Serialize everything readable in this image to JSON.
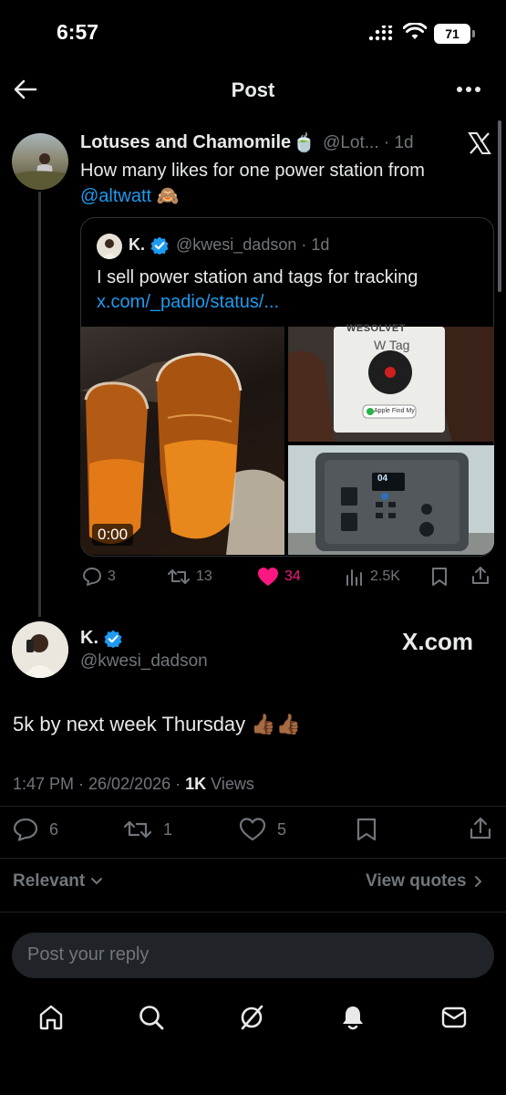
{
  "status_bar": {
    "time": "6:57",
    "battery": "71"
  },
  "header": {
    "title": "Post"
  },
  "parent_post": {
    "author_name": "Lotuses and Chamomile",
    "author_emoji": "🍵",
    "handle_time": "@Lot... · 1d",
    "text_line1": "How many likes for one power station from",
    "mention": "@altwatt",
    "text_emoji": "🙈",
    "quoted": {
      "author_name": "K.",
      "handle_time": "@kwesi_dadson · 1d",
      "text": "I sell power station and tags for tracking",
      "link": "x.com/_padio/status/...",
      "video_duration": "0:00",
      "tag_brand": "WESOLVET",
      "tag_label": "W Tag",
      "tag_badge": "Apple Find My",
      "station_display": "04"
    },
    "stats": {
      "replies": "3",
      "reposts": "13",
      "likes": "34",
      "views": "2.5K"
    },
    "like_color": "#f91880"
  },
  "main_post": {
    "author_name": "K.",
    "handle": "@kwesi_dadson",
    "brand": "X.com",
    "text": "5k by next week Thursday 👍🏾👍🏾",
    "timestamp": "1:47 PM · 26/02/2026 · ",
    "views_count": "1K",
    "views_label": " Views",
    "stats": {
      "replies": "6",
      "reposts": "1",
      "likes": "5"
    }
  },
  "filters": {
    "sort": "Relevant",
    "quotes": "View quotes"
  },
  "reply": {
    "placeholder": "Post your reply"
  },
  "tab_bar": {
    "items": [
      "home-icon",
      "search-icon",
      "grok-icon",
      "notifications-icon",
      "messages-icon"
    ]
  },
  "colors": {
    "accent": "#1d9bf0",
    "muted": "#71767b",
    "like": "#f91880"
  }
}
